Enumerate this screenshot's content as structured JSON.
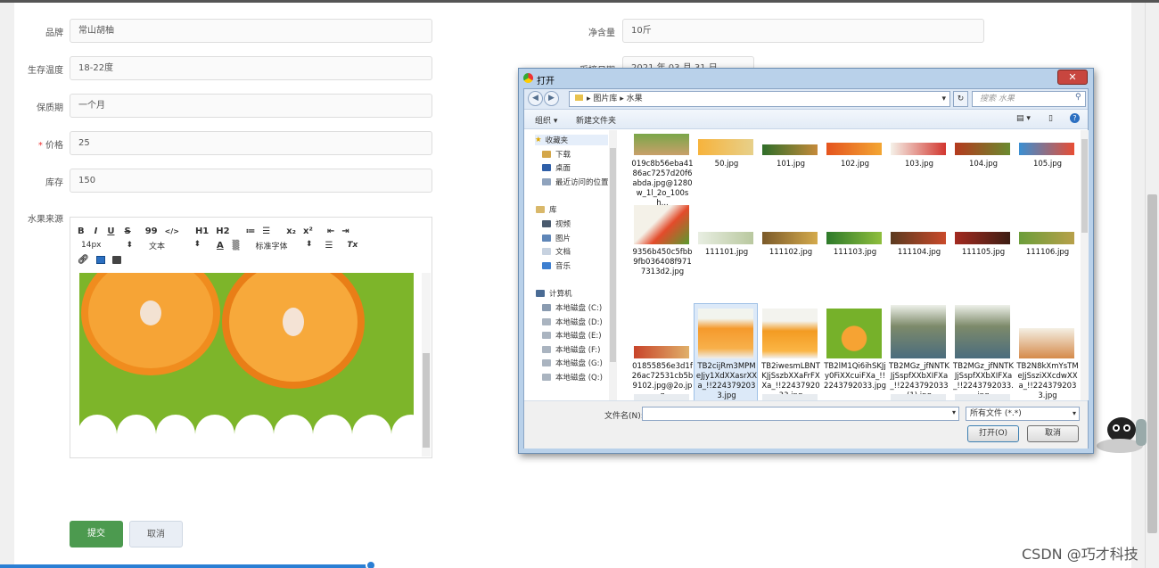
{
  "form": {
    "brand": {
      "label": "品牌",
      "value": "常山胡柚"
    },
    "net_weight": {
      "label": "净含量",
      "value": "10斤"
    },
    "temp": {
      "label": "生存温度",
      "value": "18-22度"
    },
    "pick_date": {
      "label": "采摘日期",
      "value": "2021 年 03 月 31 日"
    },
    "shelf": {
      "label": "保质期",
      "value": "一个月"
    },
    "price": {
      "label": "价格",
      "required": "*",
      "value": "25"
    },
    "stock": {
      "label": "库存",
      "value": "150"
    },
    "source": {
      "label": "水果来源"
    },
    "submit": "提交",
    "cancel": "取消"
  },
  "editor": {
    "toolbar1": [
      "B",
      "I",
      "U",
      "S",
      "99",
      "</>",
      "H1",
      "H2",
      "≔",
      "☰",
      "x₂",
      "x²",
      "⇤",
      "⇥"
    ],
    "fontsize": "14px",
    "blocktype": "文本",
    "fontfamily": "标准字体",
    "textcolor": "A",
    "clear": "Tx"
  },
  "dialog": {
    "title": "打开",
    "path": [
      "图片库",
      "水果"
    ],
    "search_placeholder": "搜索 水果",
    "organize": "组织 ▾",
    "new_folder": "新建文件夹",
    "nav": {
      "favorites": "收藏夹",
      "downloads": "下载",
      "desktop": "桌面",
      "recent": "最近访问的位置",
      "libraries": "库",
      "videos": "视频",
      "pictures": "图片",
      "documents": "文档",
      "music": "音乐",
      "computer": "计算机",
      "drives": [
        "本地磁盘 (C:)",
        "本地磁盘 (D:)",
        "本地磁盘 (E:)",
        "本地磁盘 (F:)",
        "本地磁盘 (G:)",
        "本地磁盘 (Q:)"
      ]
    },
    "files_row1": [
      "019c8b56eba4186ac7257d20f6abda.jpg@1280w_1l_2o_100sh...",
      "50.jpg",
      "101.jpg",
      "102.jpg",
      "103.jpg",
      "104.jpg",
      "105.jpg"
    ],
    "files_row2": [
      "9356b450c5fbb9fb036408f9717313d2.jpg",
      "111101.jpg",
      "111102.jpg",
      "111103.jpg",
      "111104.jpg",
      "111105.jpg",
      "111106.jpg"
    ],
    "files_row3": [
      "01855856e3d1f26ac72531cb5b9102.jpg@2o.jpg",
      "TB2cijRm3MPMeJjy1XdXXasrXXa_!!2243792033.jpg",
      "TB2iwesmLBNTKJjSszbXXaFrFXXa_!!2243792033.jpg",
      "TB2lM1Qi6ihSKJjy0FiXXcuiFXa_!!2243792033.jpg",
      "TB2MGz_jfNNTKJjSspfXXbXIFXa_!!2243792033(1).jpg",
      "TB2MGz_jfNNTKJjSspfXXbXIFXa_!!2243792033.jpg",
      "TB2N8kXmYsTMeJjSsziXXcdwXXa_!!2243792033.jpg"
    ],
    "filename_label": "文件名(N):",
    "filetype": "所有文件 (*.*)",
    "open": "打开(O)",
    "cancel": "取消"
  },
  "watermark": "CSDN @巧才科技"
}
